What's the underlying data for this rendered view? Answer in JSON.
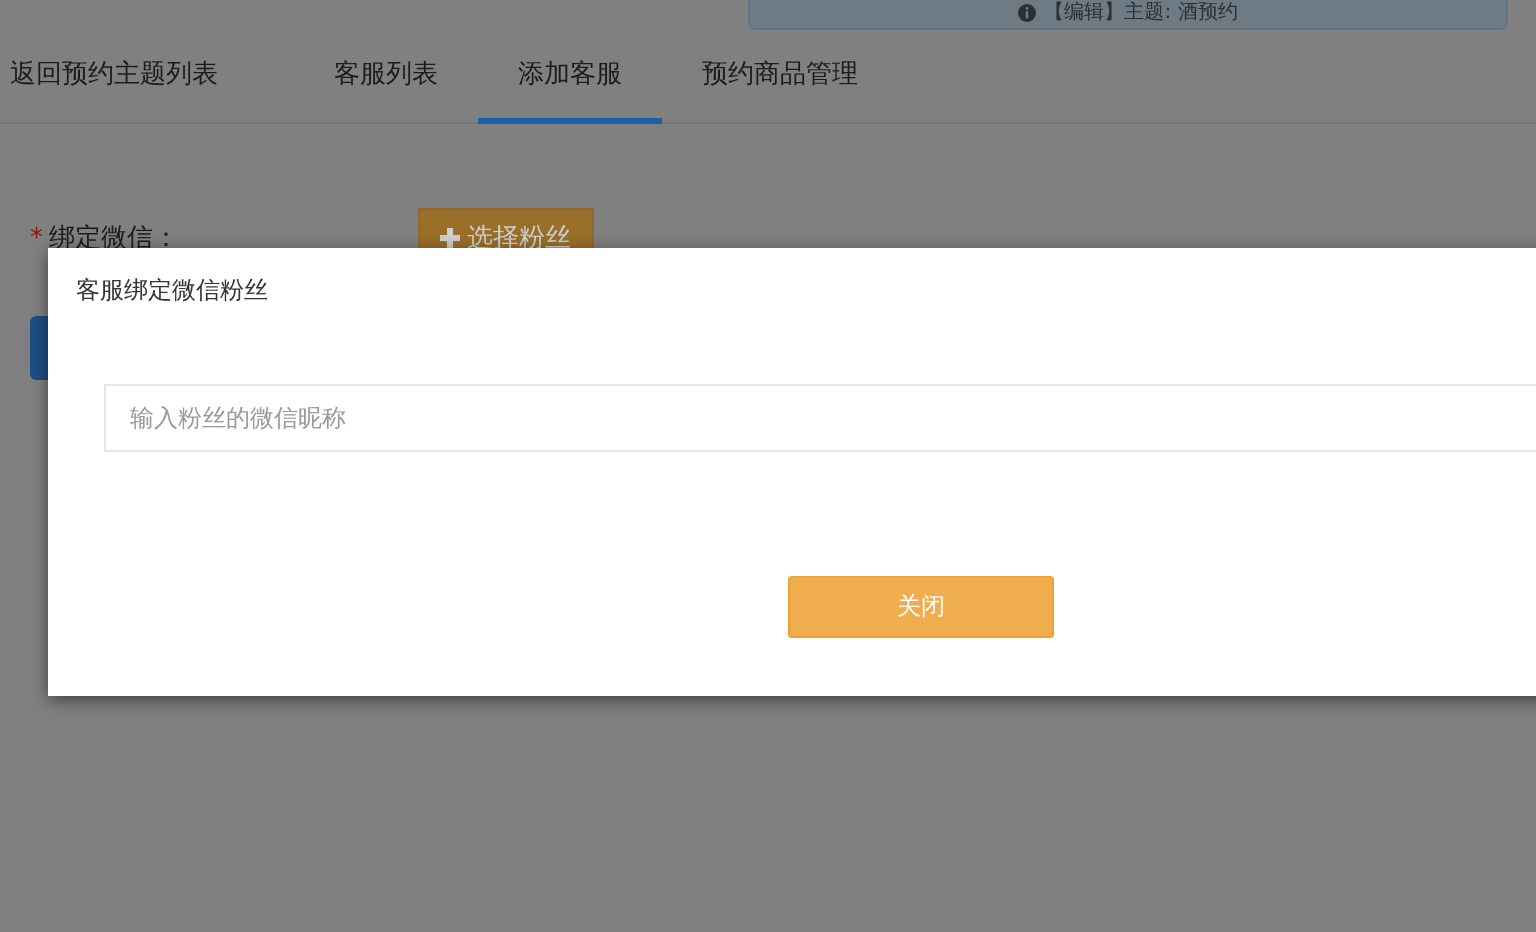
{
  "banner": {
    "text": "【编辑】主题: 酒预约"
  },
  "tabs": [
    {
      "label": "返回预约主题列表",
      "selected": false
    },
    {
      "label": "客服列表",
      "selected": false
    },
    {
      "label": "添加客服",
      "selected": true
    },
    {
      "label": "预约商品管理",
      "selected": false
    }
  ],
  "form": {
    "required_mark": "*",
    "label": "绑定微信：",
    "pick_button": "选择粉丝"
  },
  "dialog": {
    "title": "客服绑定微信粉丝",
    "search": {
      "placeholder": "输入粉丝的微信昵称"
    },
    "close_button": "关闭"
  }
}
